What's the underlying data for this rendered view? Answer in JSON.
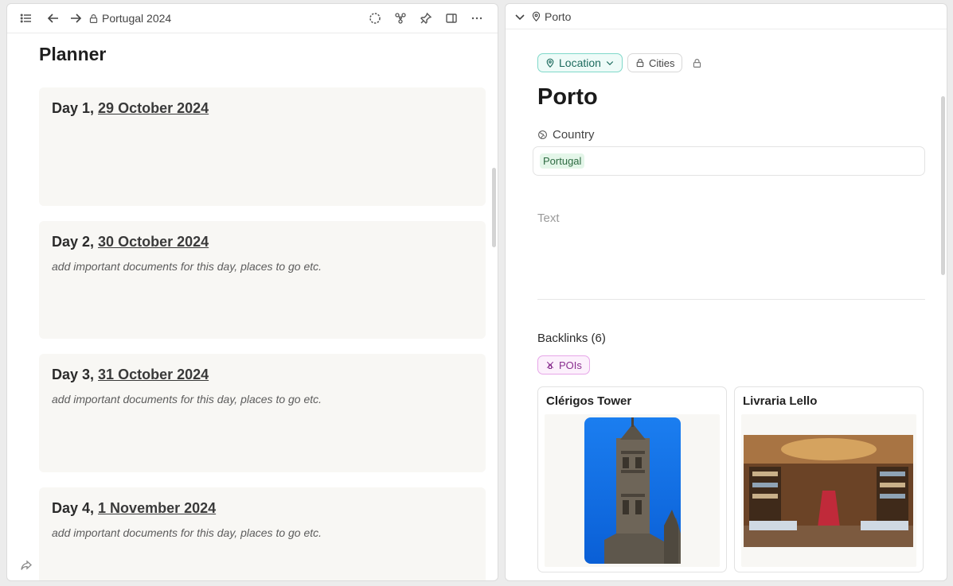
{
  "left": {
    "breadcrumb": "Portugal 2024",
    "title": "Planner",
    "days": [
      {
        "label": "Day 1, ",
        "date": "29 October 2024",
        "note": ""
      },
      {
        "label": "Day 2, ",
        "date": "30 October 2024",
        "note": "add important documents for this day, places to go etc."
      },
      {
        "label": "Day 3, ",
        "date": "31 October 2024",
        "note": "add important documents for this day, places to go etc."
      },
      {
        "label": "Day 4, ",
        "date": "1 November 2024",
        "note": "add important documents for this day, places to go etc."
      }
    ]
  },
  "right": {
    "breadcrumb": "Porto",
    "tags": {
      "location": "Location",
      "cities": "Cities"
    },
    "title": "Porto",
    "property": {
      "label": "Country",
      "value": "Portugal"
    },
    "text_placeholder": "Text",
    "backlinks": "Backlinks (6)",
    "pois_tag": "POIs",
    "cards": [
      {
        "title": "Clérigos Tower"
      },
      {
        "title": "Livraria Lello"
      }
    ]
  },
  "colors": {
    "location_accent": "#7fd8c9",
    "pois_accent": "#e7a7e9",
    "country_chip": "#e4f6e9",
    "card_bg": "#f8f7f4"
  },
  "icons": {
    "left_toolbar": [
      "list-icon",
      "back-arrow-icon",
      "forward-arrow-icon",
      "lock-icon",
      "sync-icon",
      "graph-icon",
      "pin-icon",
      "sidebar-icon",
      "more-icon"
    ],
    "right_toolbar": [
      "chevron-down-icon",
      "location-pin-icon"
    ]
  }
}
